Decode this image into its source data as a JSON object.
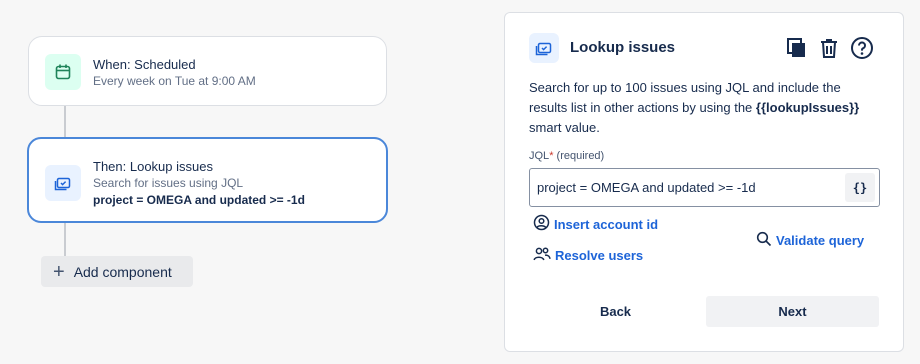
{
  "flow": {
    "trigger": {
      "title": "When: Scheduled",
      "subtitle": "Every week on Tue at 9:00 AM",
      "icon": "calendar-icon"
    },
    "action": {
      "title": "Then: Lookup issues",
      "subtitle": "Search for issues using JQL",
      "query": "project = OMEGA and updated >= -1d",
      "icon": "lookup-issues-icon"
    },
    "add_component_label": "Add component"
  },
  "panel": {
    "title": "Lookup issues",
    "description_prefix": "Search for up to 100 issues using JQL and include the results list in other actions by using the",
    "smart_value": "{{lookupIssues}}",
    "description_suffix": "smart value.",
    "jql_label": "JQL",
    "jql_required_star": "*",
    "jql_required_text": "(required)",
    "jql_value": "project = OMEGA and updated >= -1d",
    "smart_value_button": "{}",
    "insert_account_label": "Insert account id",
    "resolve_users_label": "Resolve users",
    "validate_query_label": "Validate query",
    "back_label": "Back",
    "next_label": "Next"
  },
  "colors": {
    "accent_blue": "#1d64d8",
    "selected_border": "#4b87d9",
    "trigger_icon_bg": "#dcfff1",
    "action_icon_bg": "#e9f2ff"
  }
}
